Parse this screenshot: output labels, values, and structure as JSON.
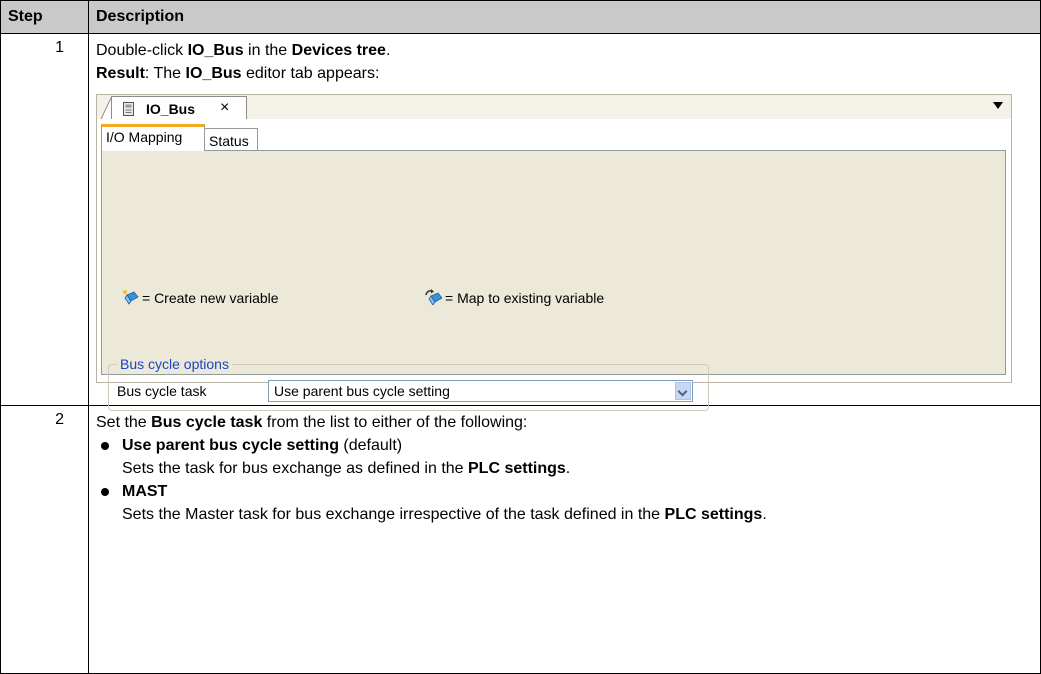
{
  "table": {
    "header": {
      "step": "Step",
      "description": "Description"
    },
    "row1": {
      "step": "1",
      "line1": {
        "a": "Double-click ",
        "b": "IO_Bus",
        "c": " in the ",
        "d": "Devices tree",
        "e": "."
      },
      "line2": {
        "a": "Result",
        "b": ": The ",
        "c": "IO_Bus",
        "d": " editor tab appears:"
      }
    },
    "row2": {
      "step": "2",
      "intro": {
        "a": "Set the ",
        "b": "Bus cycle task",
        "c": " from the list to either of the following:"
      },
      "items": [
        {
          "title": "Use parent bus cycle setting",
          "title_suffix": " (default)",
          "desc_a": "Sets the task for bus exchange as defined in the ",
          "desc_b": "PLC settings",
          "desc_c": "."
        },
        {
          "title": "MAST",
          "title_suffix": "",
          "desc_a": "Sets the Master task for bus exchange irrespective of the task defined in the ",
          "desc_b": "PLC settings",
          "desc_c": "."
        }
      ]
    }
  },
  "editor": {
    "doc_tab_label": "IO_Bus",
    "doc_tab_close": "×",
    "doc_tab_icon": "device-icon",
    "menu_icon": "dropdown-arrow-icon",
    "tabs": [
      "I/O Mapping",
      "Status"
    ],
    "legend_create": "= Create new variable",
    "legend_map": "= Map to existing variable",
    "group_title": "Bus cycle options",
    "bus_cycle_label": "Bus cycle task",
    "bus_cycle_value": "Use parent bus cycle setting",
    "colors": {
      "tab_accent": "#f5a623",
      "panel_bg": "#ece9d8",
      "group_title": "#1a46c8"
    }
  }
}
